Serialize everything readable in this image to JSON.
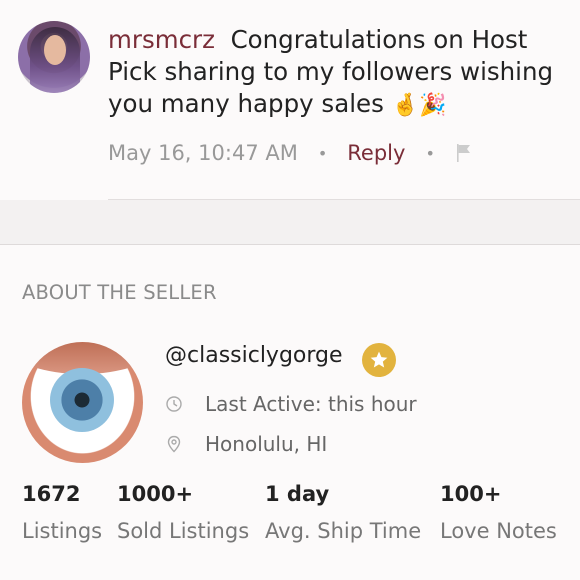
{
  "comment": {
    "username": "mrsmcrz",
    "text": "Congratulations on Host Pick sharing to my followers wishing you many happy sales",
    "emojis": "🤞🎉",
    "timestamp": "May 16, 10:47 AM",
    "reply_label": "Reply",
    "separator": "•",
    "icons": {
      "avatar": "user-avatar",
      "flag": "flag-icon"
    },
    "colors": {
      "username": "#7a2d38",
      "reply": "#7a2d38"
    }
  },
  "about": {
    "title": "ABOUT THE SELLER"
  },
  "seller": {
    "handle": "@classiclygorge",
    "last_active": "Last Active: this hour",
    "location": "Honolulu, HI",
    "icons": {
      "badge": "star-badge-icon",
      "clock": "clock-icon",
      "location": "location-pin-icon"
    },
    "colors": {
      "badge": "#e2b33e"
    }
  },
  "stats": [
    {
      "value": "1672",
      "label": "Listings"
    },
    {
      "value": "1000+",
      "label": "Sold Listings"
    },
    {
      "value": "1 day",
      "label": "Avg. Ship Time"
    },
    {
      "value": "100+",
      "label": "Love Notes"
    }
  ]
}
